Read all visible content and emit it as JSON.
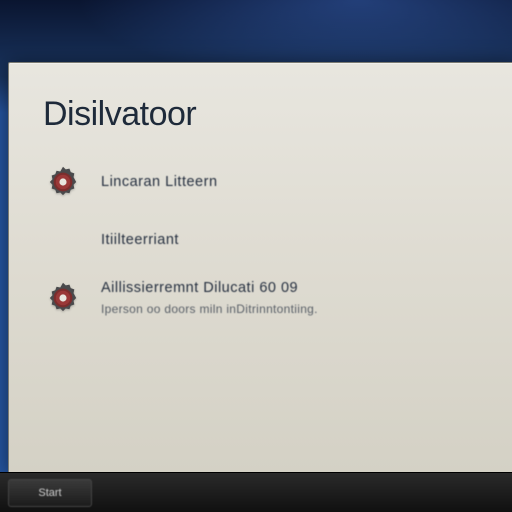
{
  "window": {
    "title": "Disilvatoor"
  },
  "items": [
    {
      "label": "Lincaran Litteern",
      "sub": ""
    },
    {
      "label": "Itiilteerriant",
      "sub": ""
    },
    {
      "label": "Aillissierremnt   Dilucati  60 09",
      "sub": "Iperson  oo doors miln inDitrinntontiing."
    }
  ],
  "taskbar": {
    "start_label": "Start"
  }
}
